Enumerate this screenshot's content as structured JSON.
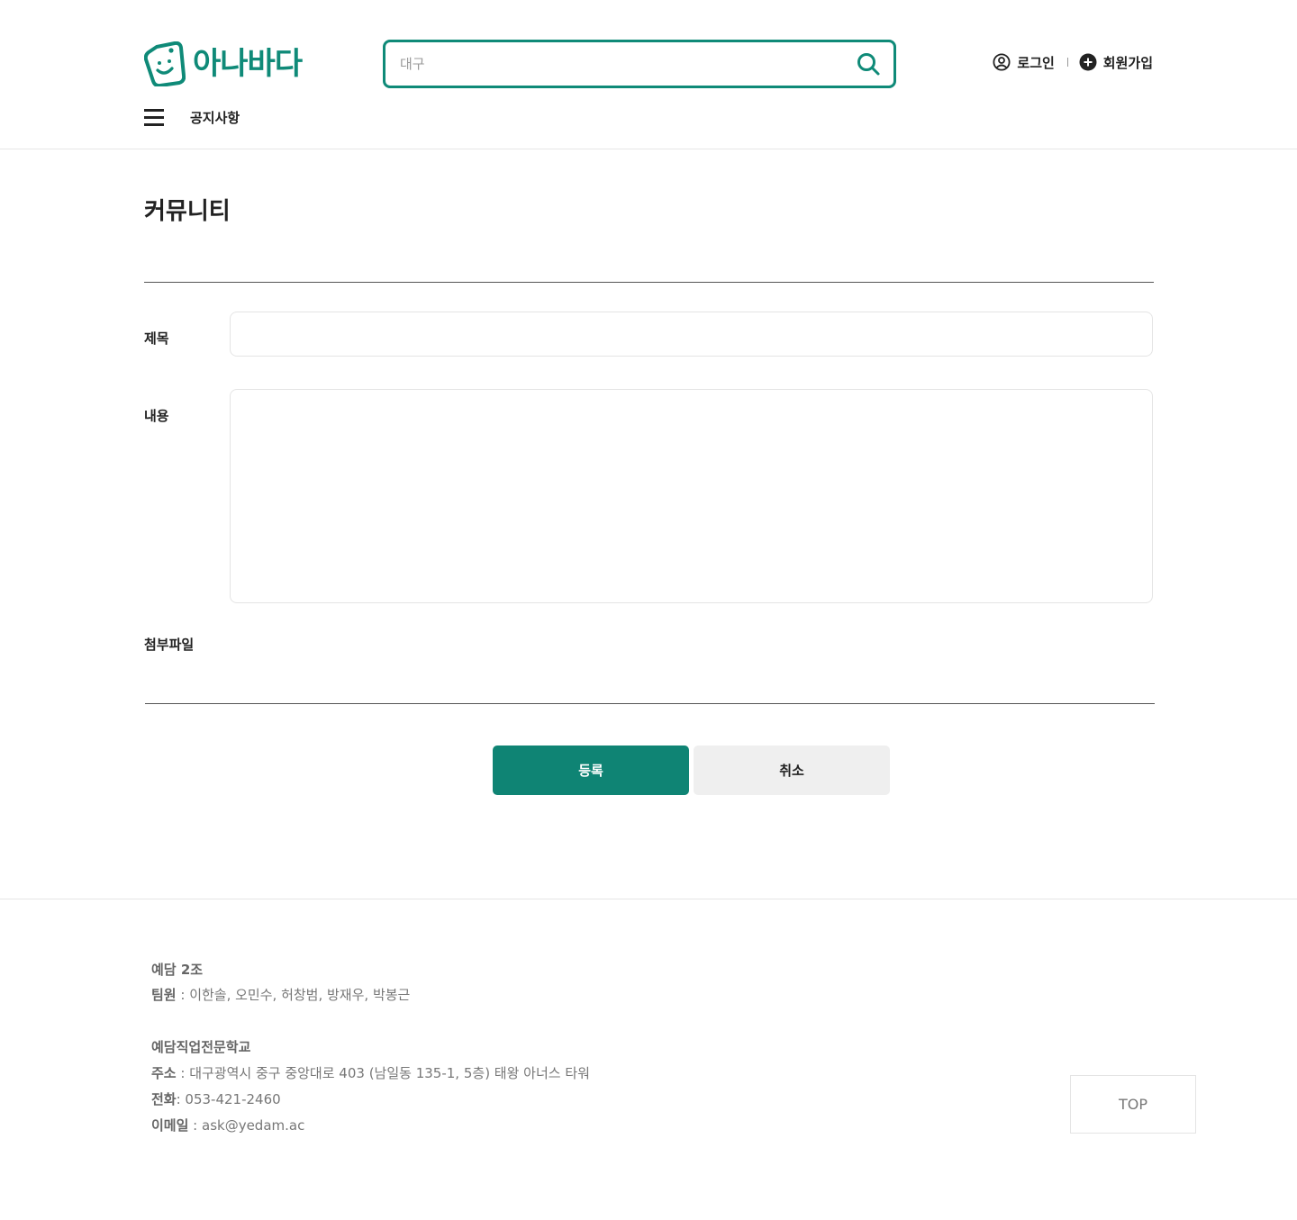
{
  "header": {
    "logo_text": "아나바다",
    "search": {
      "value": "",
      "placeholder": "대구"
    },
    "login_label": "로그인",
    "signup_label": "회원가입",
    "nav_notice": "공지사항"
  },
  "main": {
    "page_title": "커뮤니티",
    "form": {
      "title_label": "제목",
      "title_value": "",
      "content_label": "내용",
      "content_value": "",
      "file_label": "첨부파일"
    },
    "submit_label": "등록",
    "cancel_label": "취소"
  },
  "footer": {
    "team_name": "예담 2조",
    "members_label": "팀원",
    "members_value": " : 이한솔, 오민수, 허창범, 방재우, 박봉근",
    "school_name": "예담직업전문학교",
    "address_label": "주소",
    "address_value": " : 대구광역시 중구 중앙대로 403 (남일동 135-1, 5층) 태왕 아너스 타워",
    "phone_label": "전화",
    "phone_value": ": 053-421-2460",
    "email_label": "이메일",
    "email_value": " : ask@yedam.ac",
    "top_label": "TOP"
  },
  "colors": {
    "brand": "#0f8a78",
    "submit": "#0f8474",
    "cancel_bg": "#efefef"
  },
  "icons": [
    "logo-tag-icon",
    "search-icon",
    "user-circle-icon",
    "plus-circle-icon",
    "hamburger-menu-icon"
  ]
}
